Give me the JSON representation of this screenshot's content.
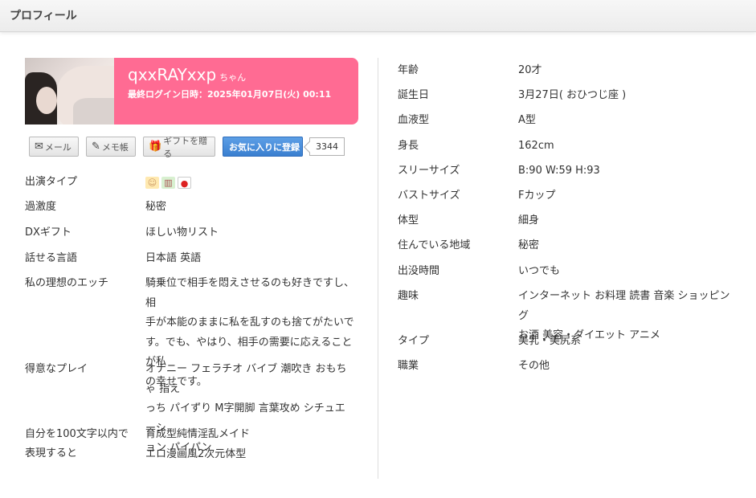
{
  "header": {
    "title": "プロフィール"
  },
  "profile": {
    "name": "qxxRAYxxp",
    "honorific": "ちゃん",
    "last_login": "最終ログイン日時：2025年01月07日(火) 00:11",
    "banner_color": "#ff6b93"
  },
  "actions": {
    "mail": "メール",
    "memo": "メモ帳",
    "gift": "ギフトを贈る",
    "favorite": "お気に入りに登録",
    "favorite_count": "3344",
    "favorite_color": "#3a7fd0"
  },
  "left_rows": [
    {
      "label": "出演タイプ",
      "icons": [
        "face-icon",
        "books-icon",
        "japan-flag-icon"
      ]
    },
    {
      "label": "過激度",
      "value": "秘密"
    },
    {
      "label": "DXギフト",
      "value": "ほしい物リスト"
    },
    {
      "label": "話せる言語",
      "value": "日本語 英語"
    },
    {
      "label": "私の理想のエッチ",
      "value_lines": [
        "騎乗位で相手を悶えさせるのも好きですし、相",
        "手が本能のままに私を乱すのも捨てがたいで",
        "す。でも、やはり、相手の需要に応えることが私",
        "の幸せです。"
      ]
    },
    {
      "label": "得意なプレイ",
      "value_lines": [
        "オナニー フェラチオ バイブ 潮吹き おもちゃ 指え",
        "っち パイずり M字開脚 言葉攻め シチュエーシ",
        "ョン パイパン"
      ]
    },
    {
      "label_lines": [
        "自分を100文字以内で",
        "表現すると"
      ],
      "value_lines": [
        "育成型純情淫乱メイド",
        "エロ漫画風2次元体型"
      ]
    }
  ],
  "right_rows": [
    {
      "label": "年齢",
      "value": "20才"
    },
    {
      "label": "誕生日",
      "value": "3月27日( おひつじ座 )"
    },
    {
      "label": "血液型",
      "value": "A型"
    },
    {
      "label": "身長",
      "value": "162cm"
    },
    {
      "label": "スリーサイズ",
      "value": "B:90 W:59 H:93"
    },
    {
      "label": "バストサイズ",
      "value": "Fカップ"
    },
    {
      "label": "体型",
      "value": "細身"
    },
    {
      "label": "住んでいる地域",
      "value": "秘密"
    },
    {
      "label": "出没時間",
      "value": "いつでも"
    },
    {
      "label": "趣味",
      "value_lines": [
        "インターネット お料理 読書 音楽 ショッピング",
        "お酒 美容・ダイエット アニメ"
      ]
    },
    {
      "label": "タイプ",
      "value": "美乳・美尻系"
    },
    {
      "label": "職業",
      "value": "その他"
    }
  ]
}
